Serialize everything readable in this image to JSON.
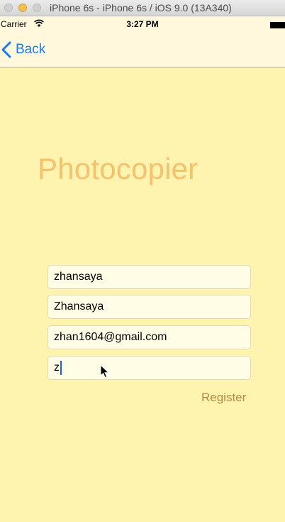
{
  "window": {
    "title": "iPhone 6s - iPhone 6s / iOS 9.0 (13A340)"
  },
  "status_bar": {
    "carrier": "Carrier",
    "time": "3:27 PM"
  },
  "nav": {
    "back_label": "Back"
  },
  "main": {
    "title": "Photocopier",
    "fields": [
      {
        "value": "zhansaya"
      },
      {
        "value": "Zhansaya"
      },
      {
        "value": "zhan1604@gmail.com"
      },
      {
        "value": "z"
      }
    ],
    "register_label": "Register"
  },
  "colors": {
    "background": "#fff3b0",
    "nav_background": "#fff8dc",
    "title": "#f5c26b",
    "link_blue": "#1a7bf0",
    "register": "#b58b3e",
    "field_background": "#fffde5"
  },
  "icons": [
    "wifi-icon",
    "battery-icon",
    "back-chevron-icon",
    "mouse-pointer-icon"
  ]
}
